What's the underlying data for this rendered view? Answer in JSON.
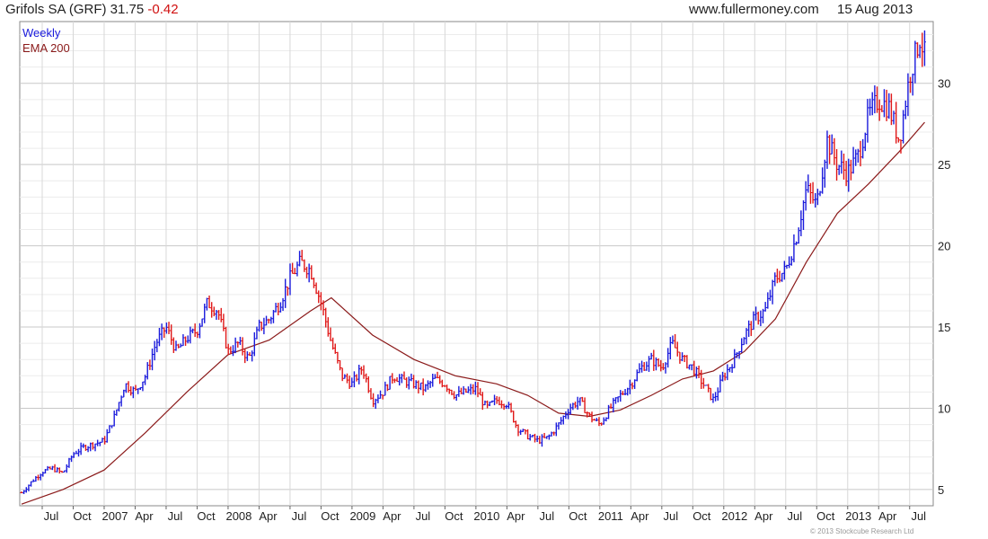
{
  "header": {
    "title": "Grifols SA (GRF) 31.75",
    "change": "-0.42",
    "website": "www.fullermoney.com",
    "date": "15 Aug 2013"
  },
  "footer": {
    "copyright": "© 2013 Stockcube Research Ltd"
  },
  "colors": {
    "up": "#1a1adc",
    "down": "#e01818",
    "ema": "#8b1a1a",
    "grid": "#d8d8d8",
    "label_weekly": "#1a1adc",
    "label_ema": "#8b1a1a"
  },
  "chart_data": {
    "type": "line",
    "title": "",
    "xlabel": "",
    "ylabel": "",
    "ylim": [
      4,
      33.8
    ],
    "yticks": [
      5,
      10,
      15,
      20,
      25,
      30
    ],
    "x_tick_labels": [
      "Jul",
      "Oct",
      "2007",
      "Apr",
      "Jul",
      "Oct",
      "2008",
      "Apr",
      "Jul",
      "Oct",
      "2009",
      "Apr",
      "Jul",
      "Oct",
      "2010",
      "Apr",
      "Jul",
      "Oct",
      "2011",
      "Apr",
      "Jul",
      "Oct",
      "2012",
      "Apr",
      "Jul",
      "Oct",
      "2013",
      "Apr",
      "Jul"
    ],
    "legend": [
      "Weekly",
      "EMA 200"
    ],
    "legend_position": "top-left",
    "grid": true,
    "x_start": "2006-05",
    "series": [
      {
        "name": "Weekly",
        "points": [
          [
            "2006-05",
            4.8
          ],
          [
            "2006-06",
            5.5
          ],
          [
            "2006-07",
            6.1
          ],
          [
            "2006-08",
            6.3
          ],
          [
            "2006-09",
            6.0
          ],
          [
            "2006-10",
            7.2
          ],
          [
            "2006-11",
            7.6
          ],
          [
            "2006-12",
            7.8
          ],
          [
            "2007-01",
            8.0
          ],
          [
            "2007-02",
            9.5
          ],
          [
            "2007-03",
            11.5
          ],
          [
            "2007-04",
            11.0
          ],
          [
            "2007-05",
            12.0
          ],
          [
            "2007-06",
            14.0
          ],
          [
            "2007-07",
            15.0
          ],
          [
            "2007-08",
            13.5
          ],
          [
            "2007-09",
            14.3
          ],
          [
            "2007-10",
            14.8
          ],
          [
            "2007-11",
            16.5
          ],
          [
            "2007-12",
            16.0
          ],
          [
            "2008-01",
            13.5
          ],
          [
            "2008-02",
            14.0
          ],
          [
            "2008-03",
            13.0
          ],
          [
            "2008-04",
            15.0
          ],
          [
            "2008-05",
            15.5
          ],
          [
            "2008-06",
            16.5
          ],
          [
            "2008-07",
            18.0
          ],
          [
            "2008-08",
            19.0
          ],
          [
            "2008-09",
            18.5
          ],
          [
            "2008-10",
            16.5
          ],
          [
            "2008-11",
            14.0
          ],
          [
            "2008-12",
            12.0
          ],
          [
            "2009-01",
            11.5
          ],
          [
            "2009-02",
            12.5
          ],
          [
            "2009-03",
            10.5
          ],
          [
            "2009-04",
            11.0
          ],
          [
            "2009-05",
            12.0
          ],
          [
            "2009-06",
            11.7
          ],
          [
            "2009-07",
            11.5
          ],
          [
            "2009-08",
            11.2
          ],
          [
            "2009-09",
            11.8
          ],
          [
            "2009-10",
            11.5
          ],
          [
            "2009-11",
            10.8
          ],
          [
            "2009-12",
            11.0
          ],
          [
            "2010-01",
            11.2
          ],
          [
            "2010-02",
            10.0
          ],
          [
            "2010-03",
            10.5
          ],
          [
            "2010-04",
            10.3
          ],
          [
            "2010-05",
            8.8
          ],
          [
            "2010-06",
            8.3
          ],
          [
            "2010-07",
            8.0
          ],
          [
            "2010-08",
            8.2
          ],
          [
            "2010-09",
            9.0
          ],
          [
            "2010-10",
            10.0
          ],
          [
            "2010-11",
            10.5
          ],
          [
            "2010-12",
            9.5
          ],
          [
            "2011-01",
            9.0
          ],
          [
            "2011-02",
            10.0
          ],
          [
            "2011-03",
            10.8
          ],
          [
            "2011-04",
            11.5
          ],
          [
            "2011-05",
            12.5
          ],
          [
            "2011-06",
            13.0
          ],
          [
            "2011-07",
            12.5
          ],
          [
            "2011-08",
            14.0
          ],
          [
            "2011-09",
            13.0
          ],
          [
            "2011-10",
            12.5
          ],
          [
            "2011-11",
            11.5
          ],
          [
            "2011-12",
            10.5
          ],
          [
            "2012-01",
            12.0
          ],
          [
            "2012-02",
            13.0
          ],
          [
            "2012-03",
            14.5
          ],
          [
            "2012-04",
            15.5
          ],
          [
            "2012-05",
            16.0
          ],
          [
            "2012-06",
            18.0
          ],
          [
            "2012-07",
            18.5
          ],
          [
            "2012-08",
            20.5
          ],
          [
            "2012-09",
            23.5
          ],
          [
            "2012-10",
            22.5
          ],
          [
            "2012-11",
            26.5
          ],
          [
            "2012-12",
            25.0
          ],
          [
            "2013-01",
            24.5
          ],
          [
            "2013-02",
            25.5
          ],
          [
            "2013-03",
            28.0
          ],
          [
            "2013-04",
            29.0
          ],
          [
            "2013-05",
            28.5
          ],
          [
            "2013-06",
            26.5
          ],
          [
            "2013-07",
            30.5
          ],
          [
            "2013-08",
            32.8
          ],
          [
            "2013-08-15",
            31.75
          ]
        ]
      },
      {
        "name": "EMA 200",
        "points": [
          [
            "2006-05",
            4.1
          ],
          [
            "2006-09",
            5.0
          ],
          [
            "2007-01",
            6.2
          ],
          [
            "2007-05",
            8.5
          ],
          [
            "2007-09",
            11.0
          ],
          [
            "2008-01",
            13.3
          ],
          [
            "2008-05",
            14.2
          ],
          [
            "2008-09",
            16.0
          ],
          [
            "2008-11",
            16.8
          ],
          [
            "2009-03",
            14.5
          ],
          [
            "2009-07",
            13.0
          ],
          [
            "2009-11",
            12.0
          ],
          [
            "2010-03",
            11.5
          ],
          [
            "2010-06",
            10.8
          ],
          [
            "2010-09",
            9.7
          ],
          [
            "2010-12",
            9.5
          ],
          [
            "2011-03",
            9.9
          ],
          [
            "2011-06",
            10.8
          ],
          [
            "2011-09",
            11.8
          ],
          [
            "2011-12",
            12.3
          ],
          [
            "2012-03",
            13.5
          ],
          [
            "2012-06",
            15.5
          ],
          [
            "2012-09",
            19.0
          ],
          [
            "2012-12",
            22.0
          ],
          [
            "2013-03",
            23.8
          ],
          [
            "2013-06",
            25.8
          ],
          [
            "2013-08-15",
            27.6
          ]
        ]
      }
    ]
  }
}
